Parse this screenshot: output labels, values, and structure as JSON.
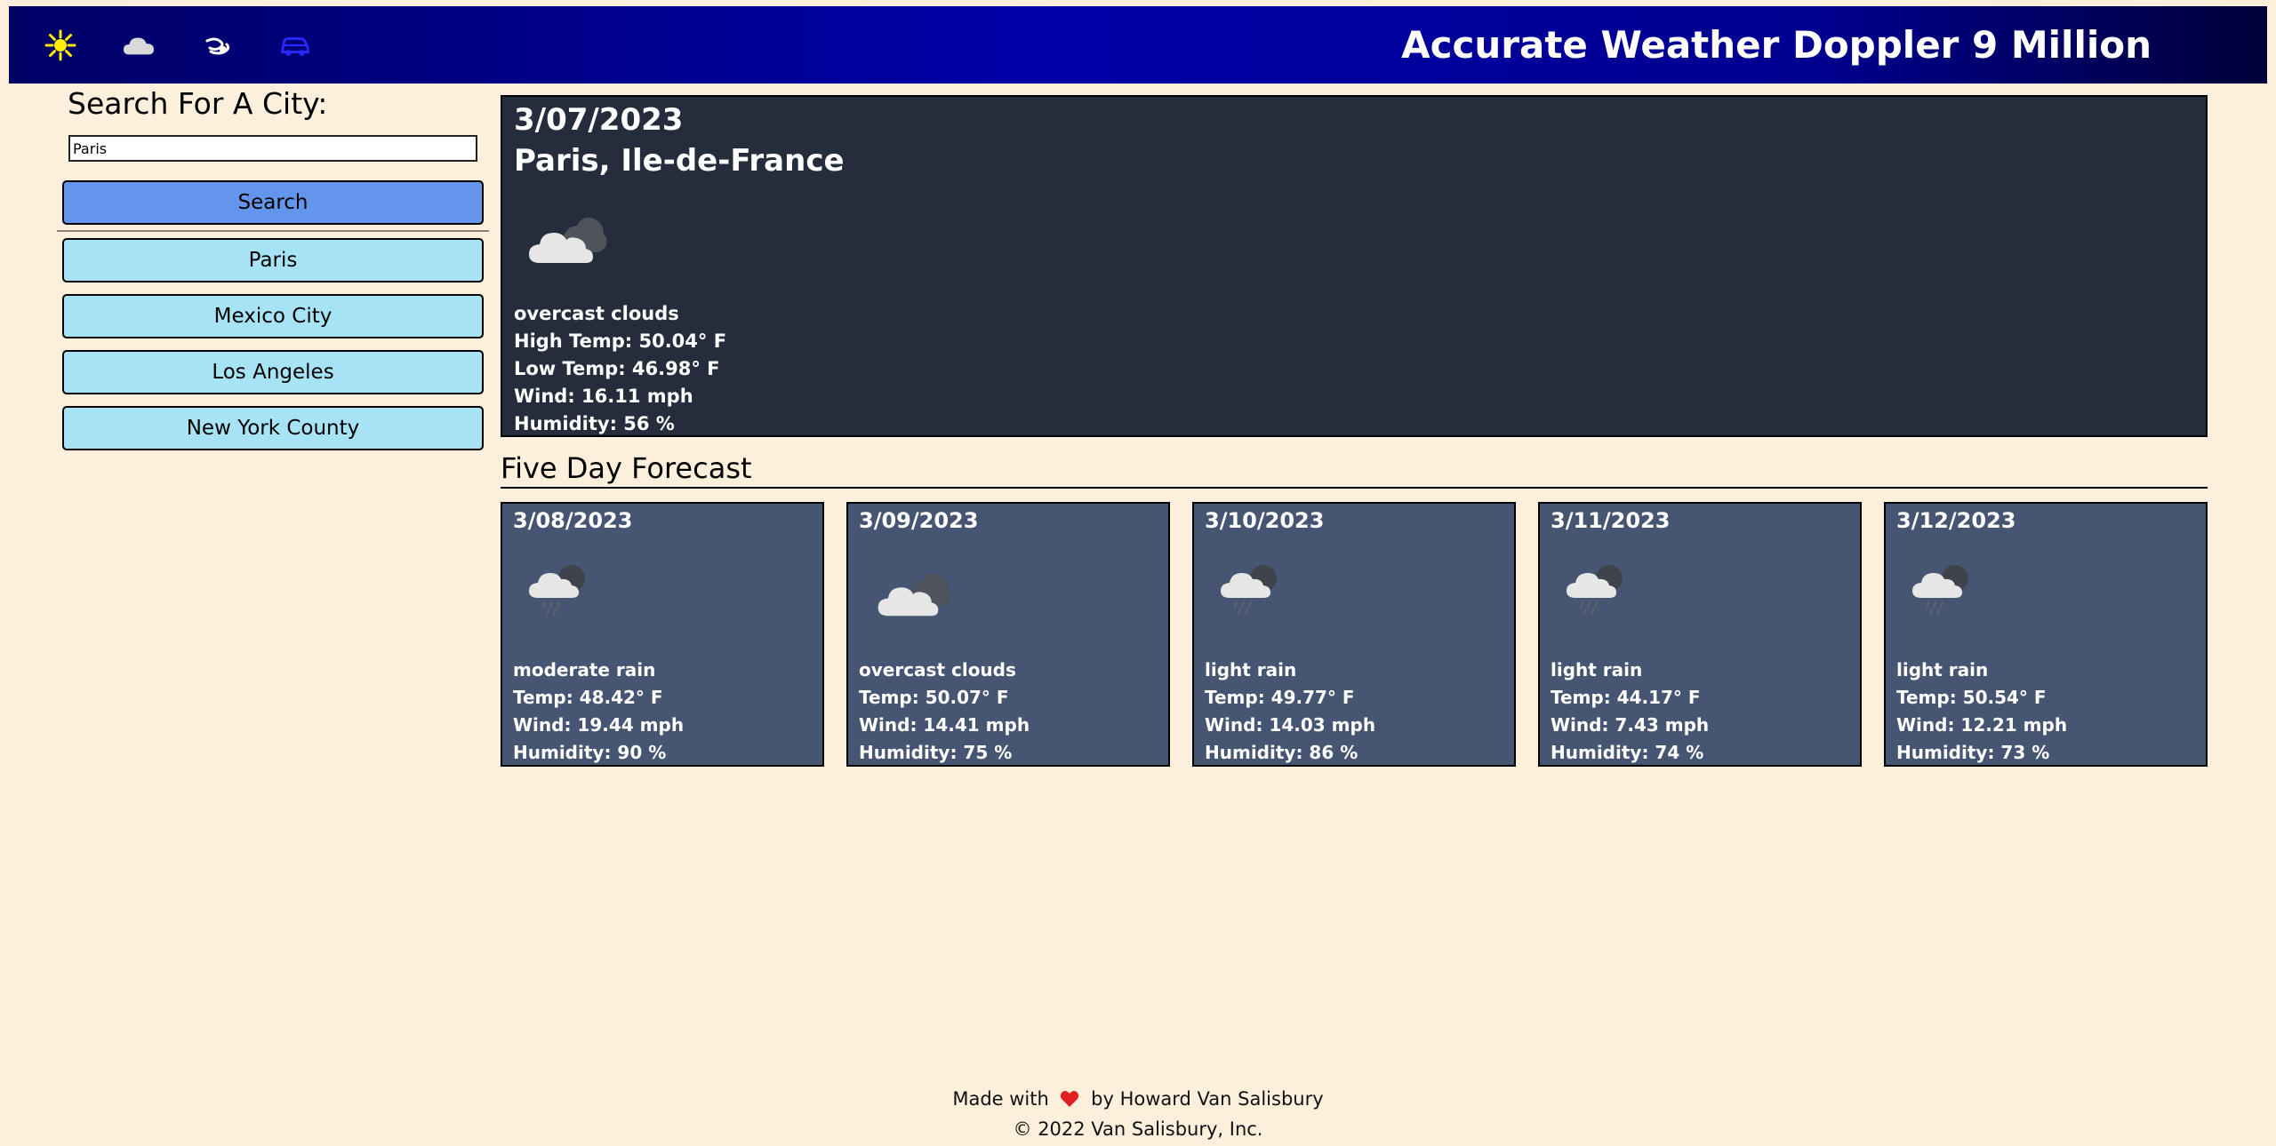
{
  "header": {
    "title": "Accurate Weather Doppler 9 Million",
    "icons": [
      "sun-icon",
      "cloud-icon",
      "wind-icon",
      "car-icon"
    ],
    "colors": {
      "sun": "#ffee00",
      "cloud": "#d9d9d9",
      "wind": "#ffffff",
      "car": "#2a2aff"
    }
  },
  "sidebar": {
    "heading": "Search For A City:",
    "search_value": "Paris",
    "search_label": "Search",
    "history": [
      "Paris",
      "Mexico City",
      "Los Angeles",
      "New York County"
    ]
  },
  "current": {
    "date": "3/07/2023",
    "location": "Paris, Ile-de-France",
    "icon": "overcast-clouds-icon",
    "description": "overcast clouds",
    "high": "High Temp: 50.04° F",
    "low": "Low Temp: 46.98° F",
    "wind": "Wind: 16.11 mph",
    "humidity": "Humidity: 56 %"
  },
  "forecast": {
    "heading": "Five Day Forecast",
    "days": [
      {
        "date": "3/08/2023",
        "icon": "rain-icon",
        "description": "moderate rain",
        "temp": "Temp: 48.42° F",
        "wind": "Wind: 19.44 mph",
        "humidity": "Humidity: 90 %"
      },
      {
        "date": "3/09/2023",
        "icon": "overcast-clouds-icon",
        "description": "overcast clouds",
        "temp": "Temp: 50.07° F",
        "wind": "Wind: 14.41 mph",
        "humidity": "Humidity: 75 %"
      },
      {
        "date": "3/10/2023",
        "icon": "rain-icon",
        "description": "light rain",
        "temp": "Temp: 49.77° F",
        "wind": "Wind: 14.03 mph",
        "humidity": "Humidity: 86 %"
      },
      {
        "date": "3/11/2023",
        "icon": "rain-icon",
        "description": "light rain",
        "temp": "Temp: 44.17° F",
        "wind": "Wind: 7.43 mph",
        "humidity": "Humidity: 74 %"
      },
      {
        "date": "3/12/2023",
        "icon": "rain-icon",
        "description": "light rain",
        "temp": "Temp: 50.54° F",
        "wind": "Wind: 12.21 mph",
        "humidity": "Humidity: 73 %"
      }
    ]
  },
  "footer": {
    "made_with": "Made with",
    "by": "by Howard Van Salisbury",
    "copyright": "© 2022 Van Salisbury, Inc."
  }
}
